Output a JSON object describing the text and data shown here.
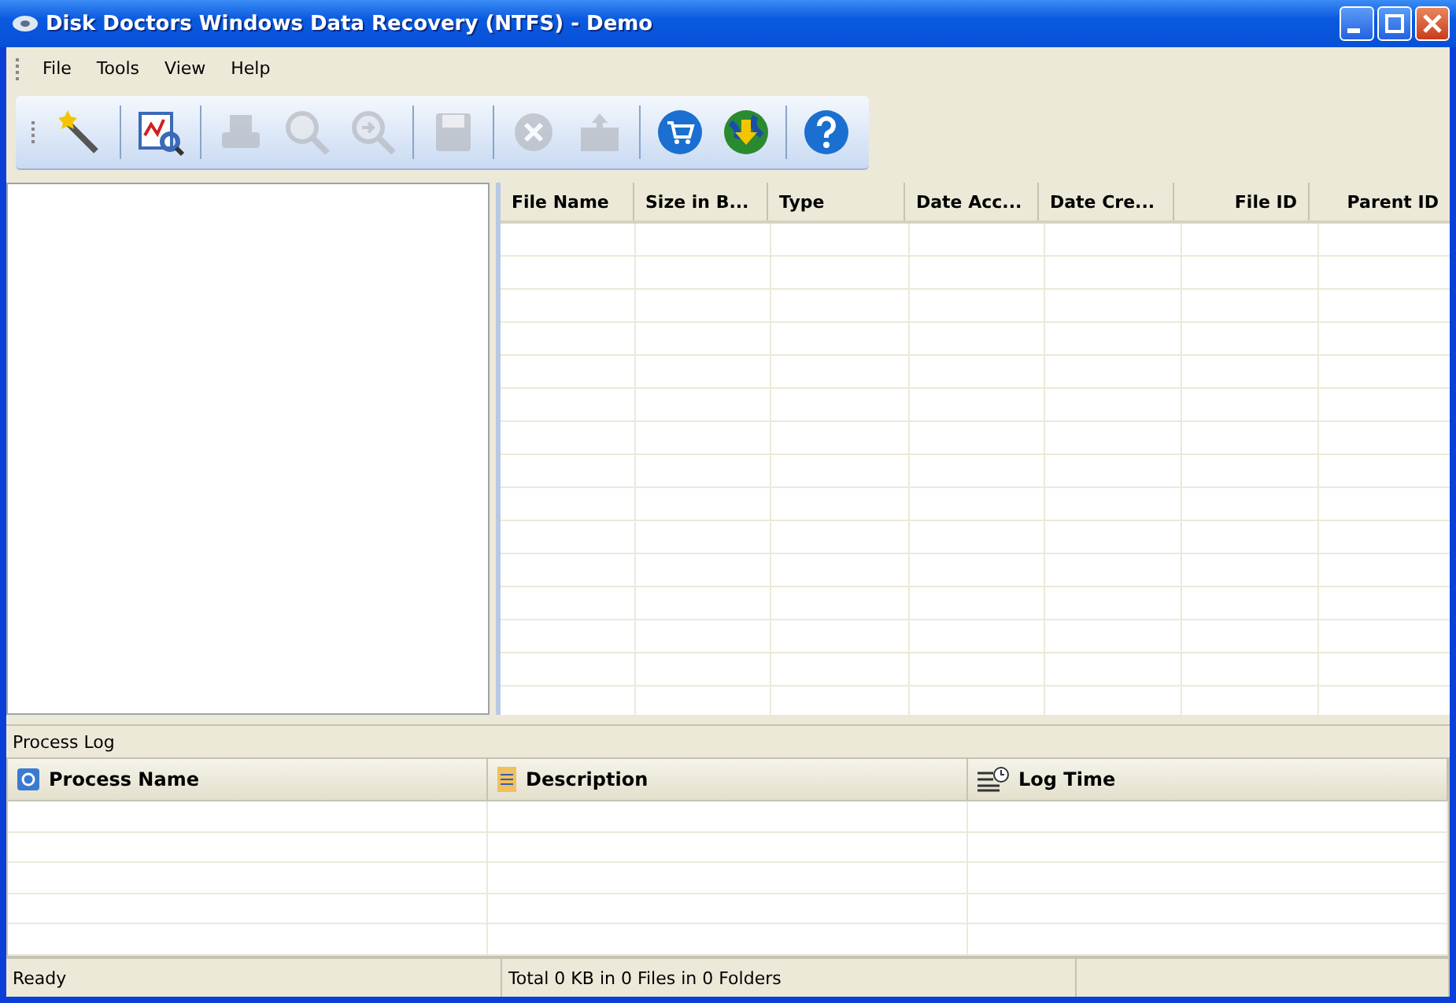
{
  "window": {
    "title": "Disk Doctors Windows Data Recovery (NTFS) - Demo"
  },
  "menu": [
    "File",
    "Tools",
    "View",
    "Help"
  ],
  "toolbar": [
    {
      "kind": "wand",
      "disabled": false
    },
    {
      "kind": "scan",
      "disabled": false
    },
    {
      "kind": "printer",
      "disabled": true
    },
    {
      "kind": "search",
      "disabled": true
    },
    {
      "kind": "search-next",
      "disabled": true
    },
    {
      "kind": "save",
      "disabled": true
    },
    {
      "kind": "cancel",
      "disabled": true
    },
    {
      "kind": "export",
      "disabled": true
    },
    {
      "kind": "cart",
      "disabled": false
    },
    {
      "kind": "globe",
      "disabled": false
    },
    {
      "kind": "help",
      "disabled": false
    }
  ],
  "file_table": {
    "columns": [
      "File Name",
      "Size in B...",
      "Type",
      "Date Acc...",
      "Date Cre...",
      "File ID",
      "Parent ID"
    ]
  },
  "process_log": {
    "title": "Process Log",
    "columns": [
      "Process Name",
      "Description",
      "Log Time"
    ]
  },
  "status_bar": [
    "Ready",
    "Total 0 KB in 0 Files in 0 Folders"
  ]
}
